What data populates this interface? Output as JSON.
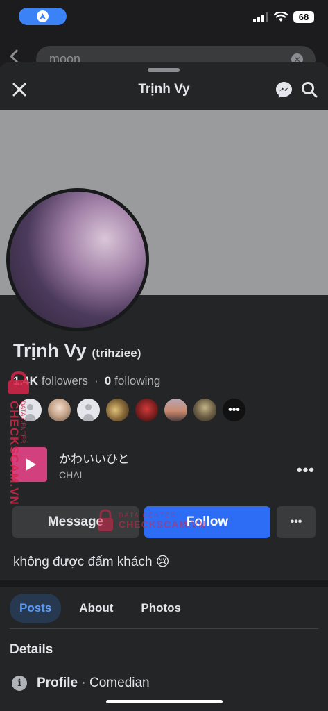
{
  "status_bar": {
    "battery": "68"
  },
  "background_search": {
    "query": "moon",
    "clear_glyph": "✕"
  },
  "header": {
    "title": "Trịnh Vy"
  },
  "profile": {
    "name": "Trịnh Vy",
    "username": "(trihziee)",
    "followers_count": "1.4K",
    "followers_label": "followers",
    "separator": "·",
    "following_count": "0",
    "following_label": "following",
    "friends_more_glyph": "•••",
    "bio": "không được đấm khách 😢"
  },
  "music": {
    "title": "かわいいひと",
    "artist": "CHAI",
    "more_glyph": "•••"
  },
  "actions": {
    "message_label": "Message",
    "follow_label": "Follow",
    "more_glyph": "•••"
  },
  "tabs": [
    {
      "label": "Posts",
      "active": true
    },
    {
      "label": "About",
      "active": false
    },
    {
      "label": "Photos",
      "active": false
    }
  ],
  "details": {
    "title": "Details",
    "rows": [
      {
        "key": "Profile",
        "value": "· Comedian",
        "icon": "info-icon"
      }
    ]
  },
  "watermark": {
    "brand": "CHECKSCAM.VN",
    "sub": "DATA CENTER",
    "main": "CHECKSCAM.VN"
  },
  "colors": {
    "accent": "#2d6df6",
    "tab_active_bg": "#263951",
    "tab_active_text": "#5b9cf5",
    "background": "#242526",
    "watermark": "#d9254a"
  }
}
